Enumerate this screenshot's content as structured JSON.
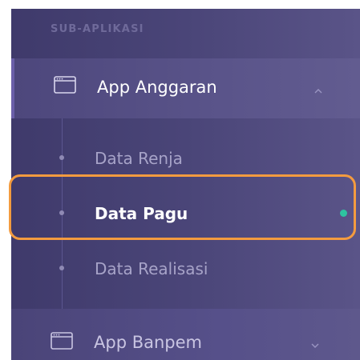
{
  "sidebar": {
    "section_label": "SUB-APLIKASI",
    "apps": [
      {
        "label": "App Anggaran",
        "icon": "app-window-icon",
        "expanded": true,
        "chevron": "chevron-up-icon",
        "sub_items": [
          {
            "label": "Data Renja",
            "active": false
          },
          {
            "label": "Data Pagu",
            "active": true
          },
          {
            "label": "Data Realisasi",
            "active": false
          }
        ]
      },
      {
        "label": "App Banpem",
        "icon": "app-window-icon",
        "expanded": false,
        "chevron": "chevron-down-icon"
      }
    ]
  },
  "colors": {
    "sidebar_bg": "#453f72",
    "active_text": "#ffffff",
    "inactive_text": "#a7a3c8",
    "status_dot": "#2ec4a0",
    "highlight": "#f39b3f"
  }
}
